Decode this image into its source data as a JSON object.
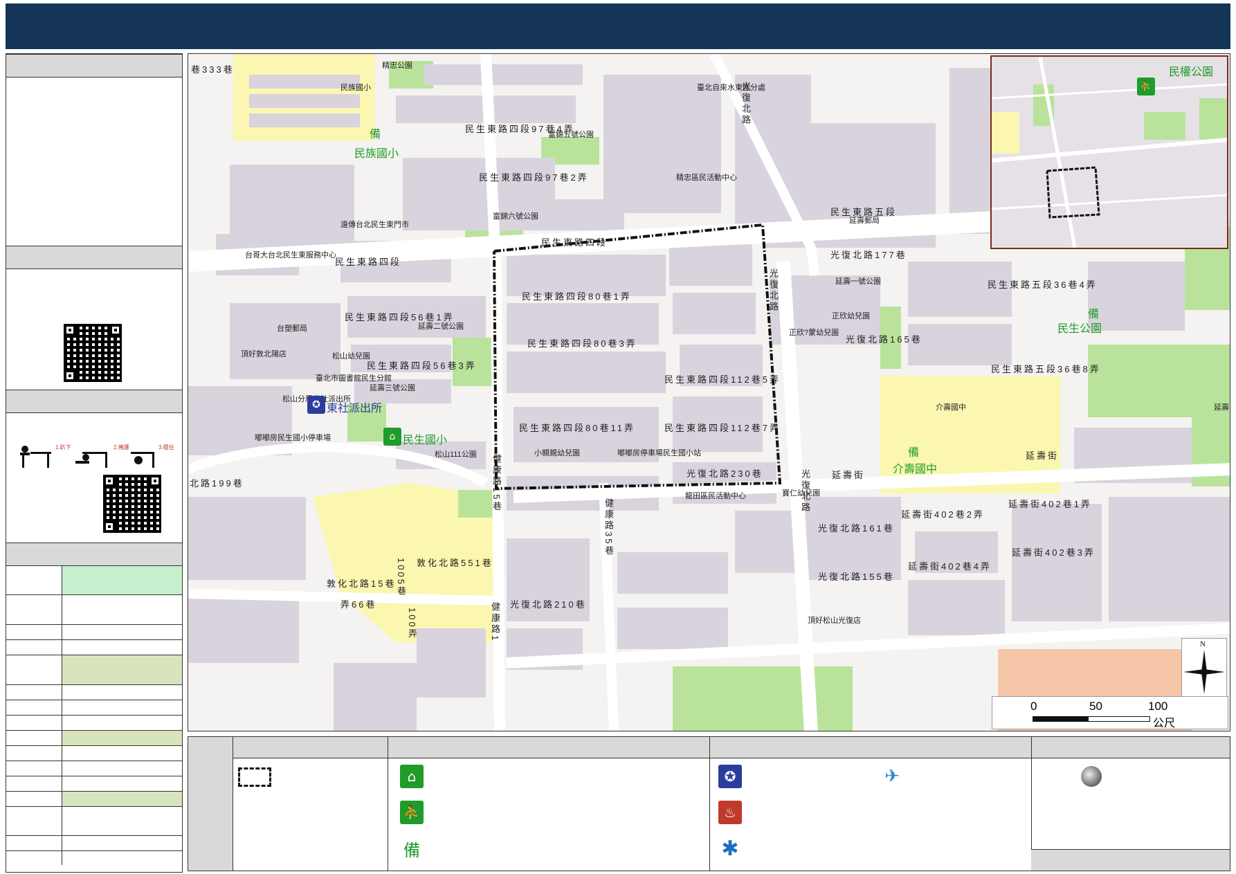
{
  "map": {
    "roads": {
      "minsheng_e4": "民生東路四段",
      "minsheng_e4_b": "民生東路四段",
      "minsheng_e5": "民生東路五段",
      "ln97_4": "民生東路四段97巷4弄",
      "ln97_2": "民生東路四段97巷2弄",
      "ln56_1": "民生東路四段56巷1弄",
      "ln56_3": "民生東路四段56巷3弄",
      "ln80_1": "民生東路四段80巷1弄",
      "ln80_3": "民生東路四段80巷3弄",
      "ln80_11": "民生東路四段80巷11弄",
      "ln112_5": "民生東路四段112巷5弄",
      "ln112_7": "民生東路四段112巷7弄",
      "ln36_4": "民生東路五段36巷4弄",
      "ln36_8": "民生東路五段36巷8弄",
      "guangfu_n177": "光復北路177巷",
      "guangfu_n165": "光復北路165巷",
      "guangfu_n230": "光復北路230巷",
      "guangfu_n161": "光復北路161巷",
      "guangfu_n155": "光復北路155巷",
      "guangfu_n210": "光復北路210巷",
      "guangfu_n": "光復北路",
      "guangfu_v2": "光復北路",
      "guangfu_v3": "光復北路",
      "yanshou": "延壽街",
      "yanshou2": "延壽街",
      "yanshou_402_1": "延壽街402巷1弄",
      "yanshou_402_2": "延壽街402巷2弄",
      "yanshou_402_3": "延壽街402巷3弄",
      "yanshou_402_4": "延壽街402巷4弄",
      "jiankang_15": "健康路15巷",
      "jiankang_35": "健康路35巷",
      "jiankang_1": "健康路1",
      "dunhua_551": "敦化北路551巷",
      "dunhua_15": "敦化北路15巷",
      "dunhua_66": "弄66巷",
      "lane_333": "巷333巷",
      "lane_199": "北路199巷",
      "lane_1005": "1005巷",
      "lane_100": "100弄"
    },
    "pois": {
      "p1": "民族國小",
      "p2": "臺北自來水東區分處",
      "p3": "富錦五號公園",
      "p4": "精忠區民活動中心",
      "p5": "富錦六號公園",
      "p6": "遠傳台北民生東門市",
      "p7": "台哥大台北民生東服務中心",
      "p8": "延壽郵局",
      "p9": "延壽一號公園",
      "p10": "正欣幼兒園",
      "p11": "正欣?蒙幼兒園",
      "p12": "延壽二號公園",
      "p13": "台塑郵局",
      "p14": "頂好敦北陽店",
      "p15": "松山幼兒園",
      "p16": "臺北市圖書館民生分館",
      "p17": "延壽三號公園",
      "p18": "松山分局東社派出所",
      "p19": "嘟嘟房民生國小停車場",
      "p20": "松山111公園",
      "p21": "小親親幼兒園",
      "p22": "嘟嘟房停車場民生國小站",
      "p23": "介壽國中",
      "p24": "龍田區民活動中心",
      "p25": "寶仁幼兒園",
      "p26": "頂好松山光復店",
      "p27": "精忠公園",
      "p28": "延壽"
    },
    "big": {
      "minzu": "民族國小",
      "dongshe": "東社派出所",
      "minsheng_school": "民生國小",
      "minsheng_park": "民生公園",
      "jieshou": "介壽國中",
      "bei": "備"
    },
    "inset": {
      "park": "民權公園"
    },
    "scale": {
      "t0": "0",
      "t50": "50",
      "t100": "100",
      "unit": "公尺"
    },
    "north": "N"
  },
  "colors": {
    "header": "#143557",
    "park": "#b9e39b",
    "school": "#fbf7b0",
    "building": "#d9d3dd",
    "road": "#ffffff"
  }
}
